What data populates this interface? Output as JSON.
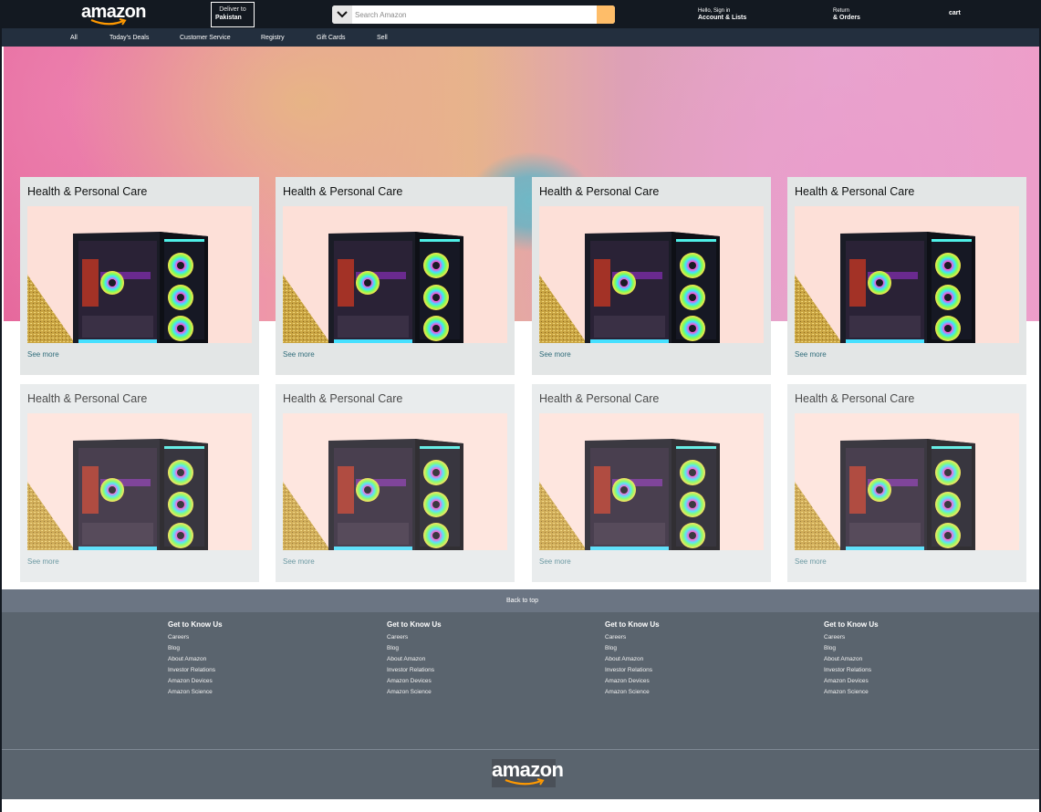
{
  "header": {
    "logo": "amazon",
    "deliver_line1": "Deliver to",
    "deliver_line2": "Pakistan",
    "search_placeholder": "Search Amazon",
    "account_line1": "Hello, Sign in",
    "account_line2": "Account & Lists",
    "orders_line1": "Return",
    "orders_line2": "& Orders",
    "cart": "cart"
  },
  "subnav": {
    "items": [
      "All",
      "Today's Deals",
      "Customer Service",
      "Registry",
      "Gift Cards",
      "Sell"
    ]
  },
  "cards": [
    {
      "title": "Health & Personal Care",
      "link": "See more"
    },
    {
      "title": "Health & Personal Care",
      "link": "See more"
    },
    {
      "title": "Health & Personal Care",
      "link": "See more"
    },
    {
      "title": "Health & Personal Care",
      "link": "See more"
    },
    {
      "title": "Health & Personal Care",
      "link": "See more"
    },
    {
      "title": "Health & Personal Care",
      "link": "See more"
    },
    {
      "title": "Health & Personal Care",
      "link": "See more"
    },
    {
      "title": "Health & Personal Care",
      "link": "See more"
    }
  ],
  "back_to_top": "Back to top",
  "footer": {
    "columns": [
      {
        "heading": "Get to Know Us",
        "links": [
          "Careers",
          "Blog",
          "About Amazon",
          "Investor Relations",
          "Amazon Devices",
          "Amazon Science"
        ]
      },
      {
        "heading": "Get to Know Us",
        "links": [
          "Careers",
          "Blog",
          "About Amazon",
          "Investor Relations",
          "Amazon Devices",
          "Amazon Science"
        ]
      },
      {
        "heading": "Get to Know Us",
        "links": [
          "Careers",
          "Blog",
          "About Amazon",
          "Investor Relations",
          "Amazon Devices",
          "Amazon Science"
        ]
      },
      {
        "heading": "Get to Know Us",
        "links": [
          "Careers",
          "Blog",
          "About Amazon",
          "Investor Relations",
          "Amazon Devices",
          "Amazon Science"
        ]
      }
    ],
    "logo": "amazon"
  },
  "colors": {
    "nav_top": "#131921",
    "nav_sub": "#232f3e",
    "search_button": "#febd69",
    "footer": "#5a646e",
    "back_to_top": "#6b7583",
    "card_bg": "#e3e6e6"
  },
  "icons": [
    "amazon-logo",
    "chevron-down-icon",
    "search-icon",
    "cart-icon",
    "gaming-pc-image"
  ]
}
